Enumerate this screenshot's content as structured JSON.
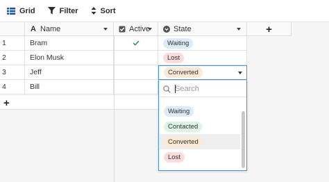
{
  "toolbar": {
    "grid_label": "Grid",
    "filter_label": "Filter",
    "sort_label": "Sort"
  },
  "columns": {
    "name": "Name",
    "active": "Active",
    "state": "State",
    "add": "+"
  },
  "rows": [
    {
      "num": "1",
      "name": "Bram",
      "active": true,
      "state": "Waiting"
    },
    {
      "num": "2",
      "name": "Elon Musk",
      "active": false,
      "state": "Lost"
    },
    {
      "num": "3",
      "name": "Jeff",
      "active": false,
      "state": "Converted"
    },
    {
      "num": "4",
      "name": "Bill",
      "active": false,
      "state": ""
    }
  ],
  "add_row_label": "+",
  "state_editor": {
    "value": "Converted",
    "search_placeholder": "Search",
    "options": [
      "Waiting",
      "Contacted",
      "Converted",
      "Lost"
    ],
    "hovered_option": "Converted"
  },
  "colors": {
    "waiting": "#dcebf7",
    "contacted": "#dcf3e6",
    "converted": "#fbe9d4",
    "lost": "#fbdcdc",
    "accent": "#4a90e2",
    "check": "#2e8b57"
  }
}
